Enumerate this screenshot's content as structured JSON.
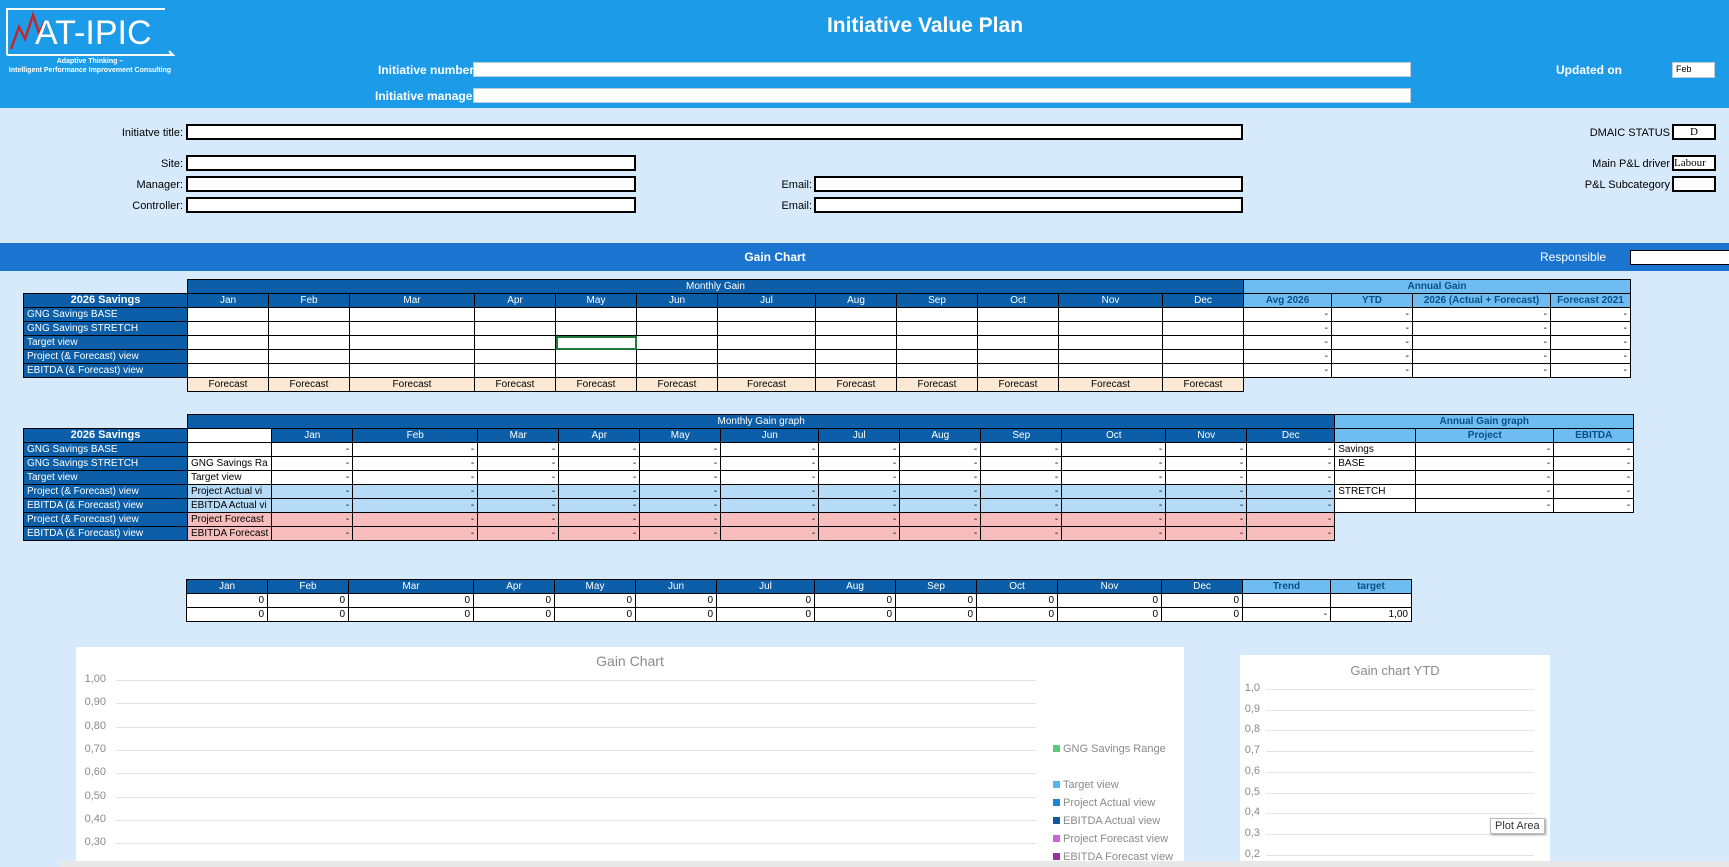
{
  "header": {
    "logo_text": "AT-IPIC",
    "logo_tag1": "Adaptive Thinking –",
    "logo_tag2": "Intelligent Performance Improvement Consulting",
    "title": "Initiative Value Plan",
    "initiative_number_label": "Initiative  number",
    "initiative_manager_label": "Initiative manager",
    "updated_on_label": "Updated on",
    "updated_on_value": "Feb"
  },
  "info": {
    "title_label": "Initiatve title:",
    "site_label": "Site:",
    "manager_label": "Manager:",
    "controller_label": "Controller:",
    "email_label": "Email:",
    "dmaic_label": "DMAIC STATUS",
    "dmaic_value": "D",
    "main_pl_label": "Main P&L driver",
    "main_pl_value": "Labour",
    "pl_sub_label": "P&L Subcategory"
  },
  "gain_bar": {
    "title": "Gain Chart",
    "responsible_label": "Responsible"
  },
  "months": [
    "Jan",
    "Feb",
    "Mar",
    "Apr",
    "May",
    "Jun",
    "Jul",
    "Aug",
    "Sep",
    "Oct",
    "Nov",
    "Dec"
  ],
  "table1": {
    "monthly_gain_label": "Monthly Gain",
    "annual_gain_label": "Annual Gain",
    "corner": "2026 Savings",
    "annual_cols": [
      "Avg 2026",
      "YTD",
      "2026 (Actual + Forecast)",
      "Forecast 2021"
    ],
    "rows": [
      "GNG Savings BASE",
      "GNG Savings STRETCH",
      "Target view",
      "Project (& Forecast) view",
      "EBITDA (& Forecast) view"
    ],
    "dash": "-",
    "forecast": "Forecast"
  },
  "table2": {
    "title": "Monthly Gain graph",
    "annual_title": "Annual Gain graph",
    "corner": "2026 Savings",
    "annual_cols": [
      "Project",
      "EBITDA"
    ],
    "rows": [
      {
        "label": "GNG Savings BASE",
        "sub": ""
      },
      {
        "label": "GNG Savings STRETCH",
        "sub": "GNG Savings Ra"
      },
      {
        "label": "Target view",
        "sub": "Target view"
      },
      {
        "label": "Project (& Forecast) view",
        "sub": "Project Actual vi"
      },
      {
        "label": "EBITDA (& Forecast) view",
        "sub": "EBITDA Actual vi"
      },
      {
        "label": "Project (& Forecast) view",
        "sub": "Project Forecast"
      },
      {
        "label": "EBITDA (& Forecast) view",
        "sub": "EBITDA Forecast"
      }
    ],
    "annual_row_labels": [
      "Savings",
      "BASE",
      "",
      "STRETCH",
      ""
    ],
    "dash": "-"
  },
  "table3": {
    "trend_label": "Trend",
    "target_label": "target",
    "zero": "0",
    "dash": "-",
    "target_value": "1,00"
  },
  "chart_data": [
    {
      "type": "line",
      "title": "Gain Chart",
      "y_ticks": [
        "1,00",
        "0,90",
        "0,80",
        "0,70",
        "0,60",
        "0,50",
        "0,40",
        "0,30"
      ],
      "series": [
        {
          "name": "GNG Savings Range",
          "color": "#5cc87a"
        },
        {
          "name": "Target view",
          "color": "#4fb6ee"
        },
        {
          "name": "Project Actual view",
          "color": "#1c86d6"
        },
        {
          "name": "EBITDA Actual view",
          "color": "#135a9c"
        },
        {
          "name": "Project Forecast view",
          "color": "#c866d6"
        },
        {
          "name": "EBITDA Forecast view",
          "color": "#9a2fa0"
        }
      ]
    },
    {
      "type": "bar",
      "title": "Gain chart YTD",
      "y_ticks": [
        "1,0",
        "0,9",
        "0,8",
        "0,7",
        "0,6",
        "0,5",
        "0,4",
        "0,3",
        "0,2"
      ],
      "tooltip": "Plot Area"
    }
  ]
}
